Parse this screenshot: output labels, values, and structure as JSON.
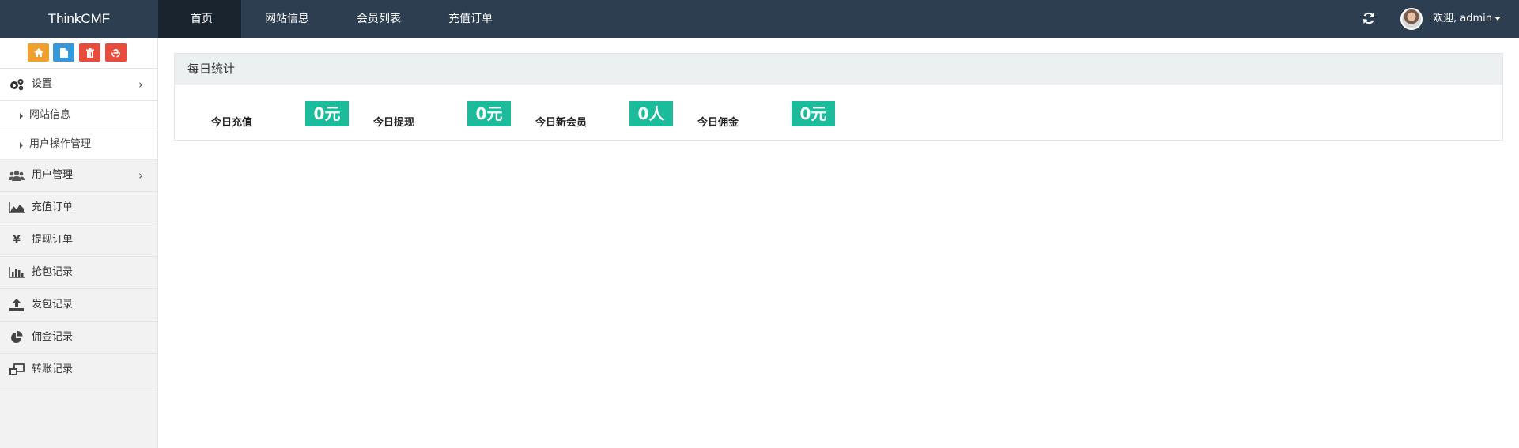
{
  "header": {
    "brand": "ThinkCMF",
    "nav": [
      {
        "label": "首页"
      },
      {
        "label": "网站信息"
      },
      {
        "label": "会员列表"
      },
      {
        "label": "充值订单"
      }
    ],
    "user": "欢迎, admin"
  },
  "sidebar": {
    "items": [
      {
        "label": "设置"
      },
      {
        "label": "网站信息"
      },
      {
        "label": "用户操作管理"
      },
      {
        "label": "用户管理"
      },
      {
        "label": "充值订单"
      },
      {
        "label": "提现订单"
      },
      {
        "label": "抢包记录"
      },
      {
        "label": "发包记录"
      },
      {
        "label": "佣金记录"
      },
      {
        "label": "转账记录"
      }
    ]
  },
  "colors": {
    "shortcut_home": "#f0a02c",
    "shortcut_doc": "#3498db",
    "shortcut_trash": "#e74c3c",
    "shortcut_recycle": "#e74c3c",
    "stat_accent": "#1abc9c"
  },
  "main": {
    "panel_title": "每日统计",
    "stats": [
      {
        "label": "今日充值",
        "value": "0元"
      },
      {
        "label": "今日提现",
        "value": "0元"
      },
      {
        "label": "今日新会员",
        "value": "0人"
      },
      {
        "label": "今日佣金",
        "value": "0元"
      }
    ]
  }
}
